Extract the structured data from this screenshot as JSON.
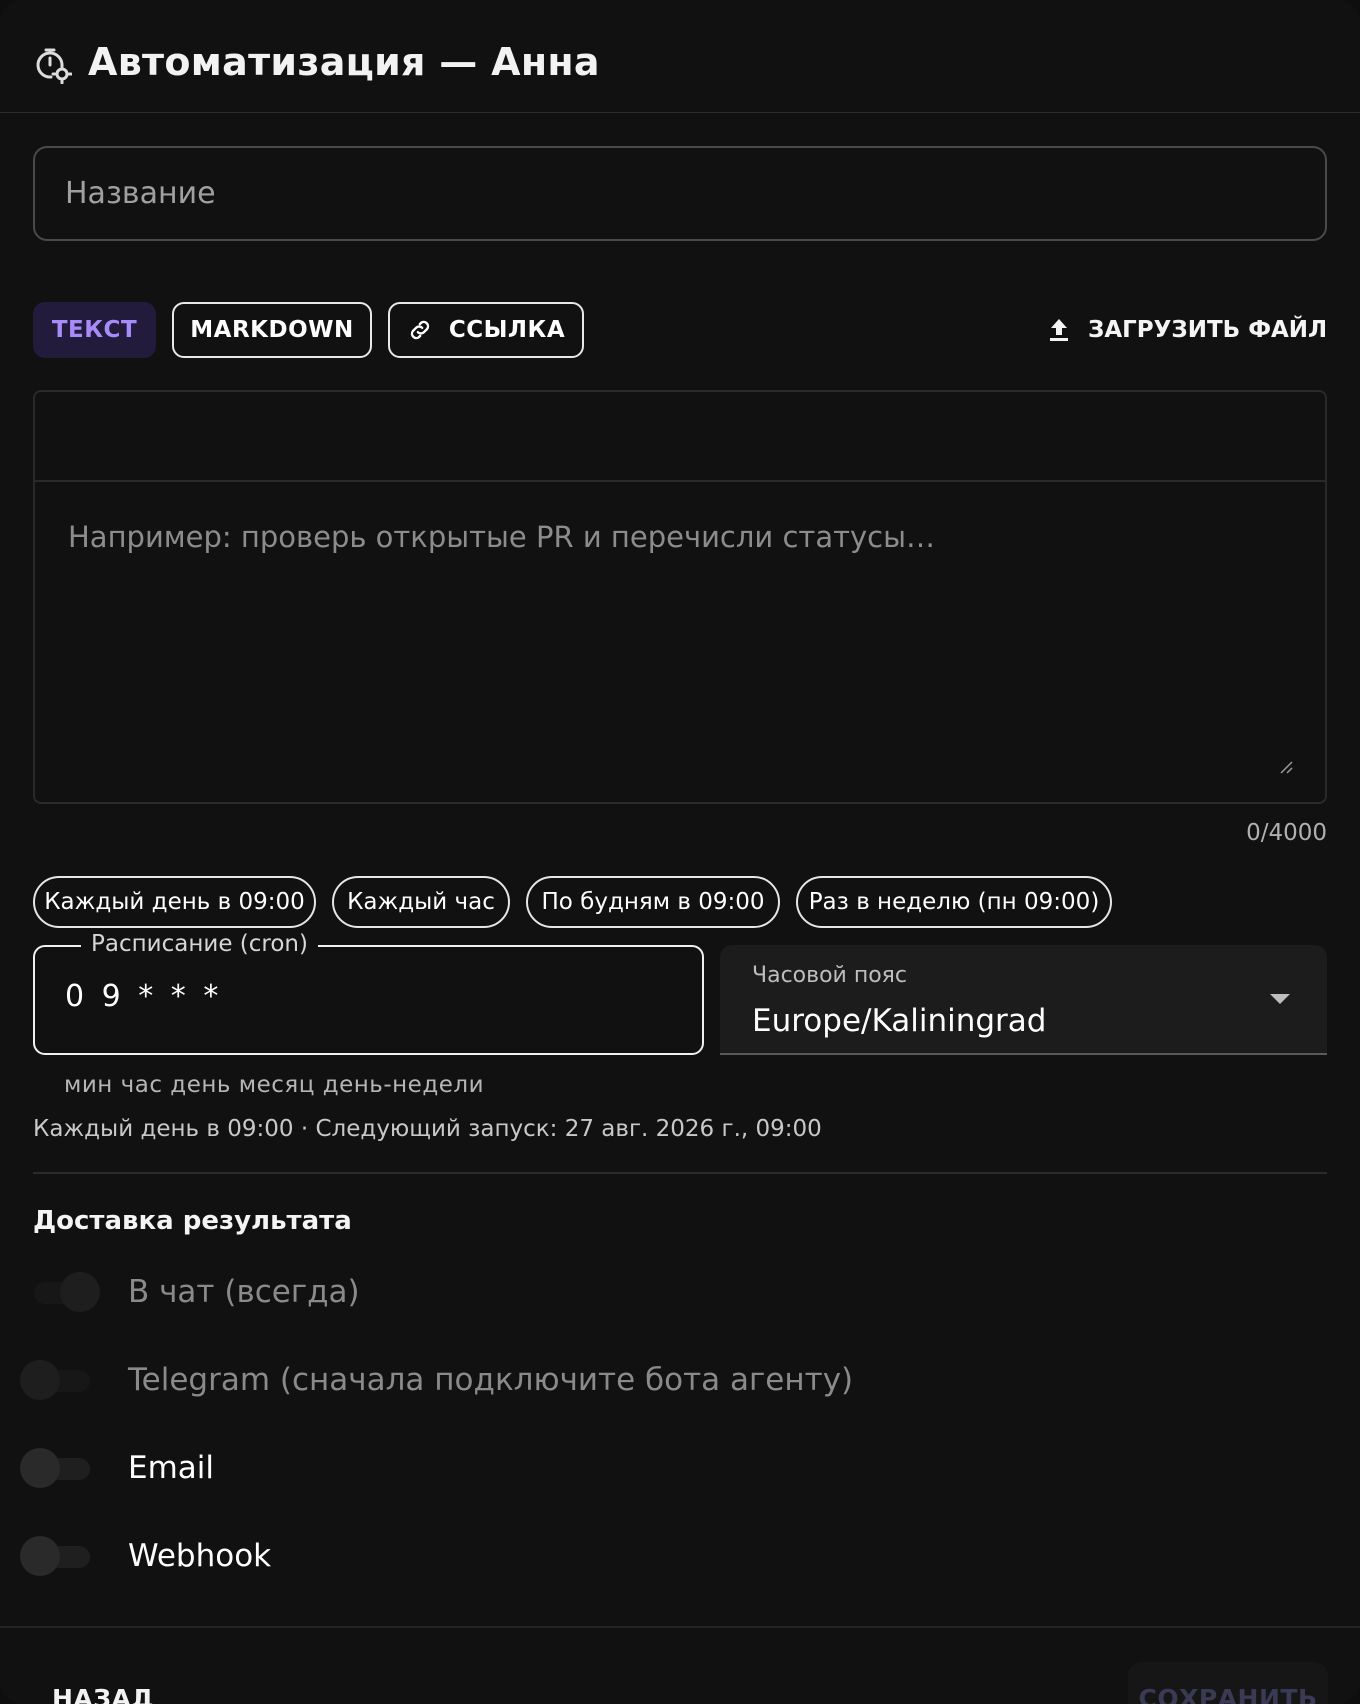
{
  "header": {
    "title": "Автоматизация — Анна",
    "icon": "timer-gear-icon"
  },
  "name_field": {
    "placeholder": "Название",
    "value": ""
  },
  "content_modes": {
    "items": [
      {
        "label": "ТЕКСТ",
        "active": true
      },
      {
        "label": "MARKDOWN",
        "active": false
      },
      {
        "label": "ССЫЛКА",
        "active": false,
        "icon": "link-icon"
      }
    ],
    "upload_label": "ЗАГРУЗИТЬ ФАЙЛ",
    "upload_icon": "upload-icon"
  },
  "editor": {
    "placeholder": "Например: проверь открытые PR и перечисли статусы…",
    "counter": "0/4000"
  },
  "presets": [
    "Каждый день в 09:00",
    "Каждый час",
    "По будням в 09:00",
    "Раз в неделю (пн 09:00)"
  ],
  "cron": {
    "label": "Расписание (cron)",
    "value": "0 9 * * *",
    "helper": "мин час день месяц день-недели"
  },
  "timezone": {
    "label": "Часовой пояс",
    "value": "Europe/Kaliningrad"
  },
  "schedule_info": "Каждый день в 09:00 · Следующий запуск: 27 авг. 2026 г., 09:00",
  "delivery": {
    "title": "Доставка результата",
    "options": [
      {
        "label": "В чат (всегда)",
        "checked": true,
        "disabled": true
      },
      {
        "label": "Telegram (сначала подключите бота агенту)",
        "checked": false,
        "disabled": true
      },
      {
        "label": "Email",
        "checked": false,
        "disabled": false
      },
      {
        "label": "Webhook",
        "checked": false,
        "disabled": false
      }
    ]
  },
  "footer": {
    "back_label": "НАЗАД",
    "save_label": "СОХРАНИТЬ"
  },
  "colors": {
    "accent": "#a78bfa",
    "accent_bg": "#231b3b",
    "background": "#111111"
  }
}
